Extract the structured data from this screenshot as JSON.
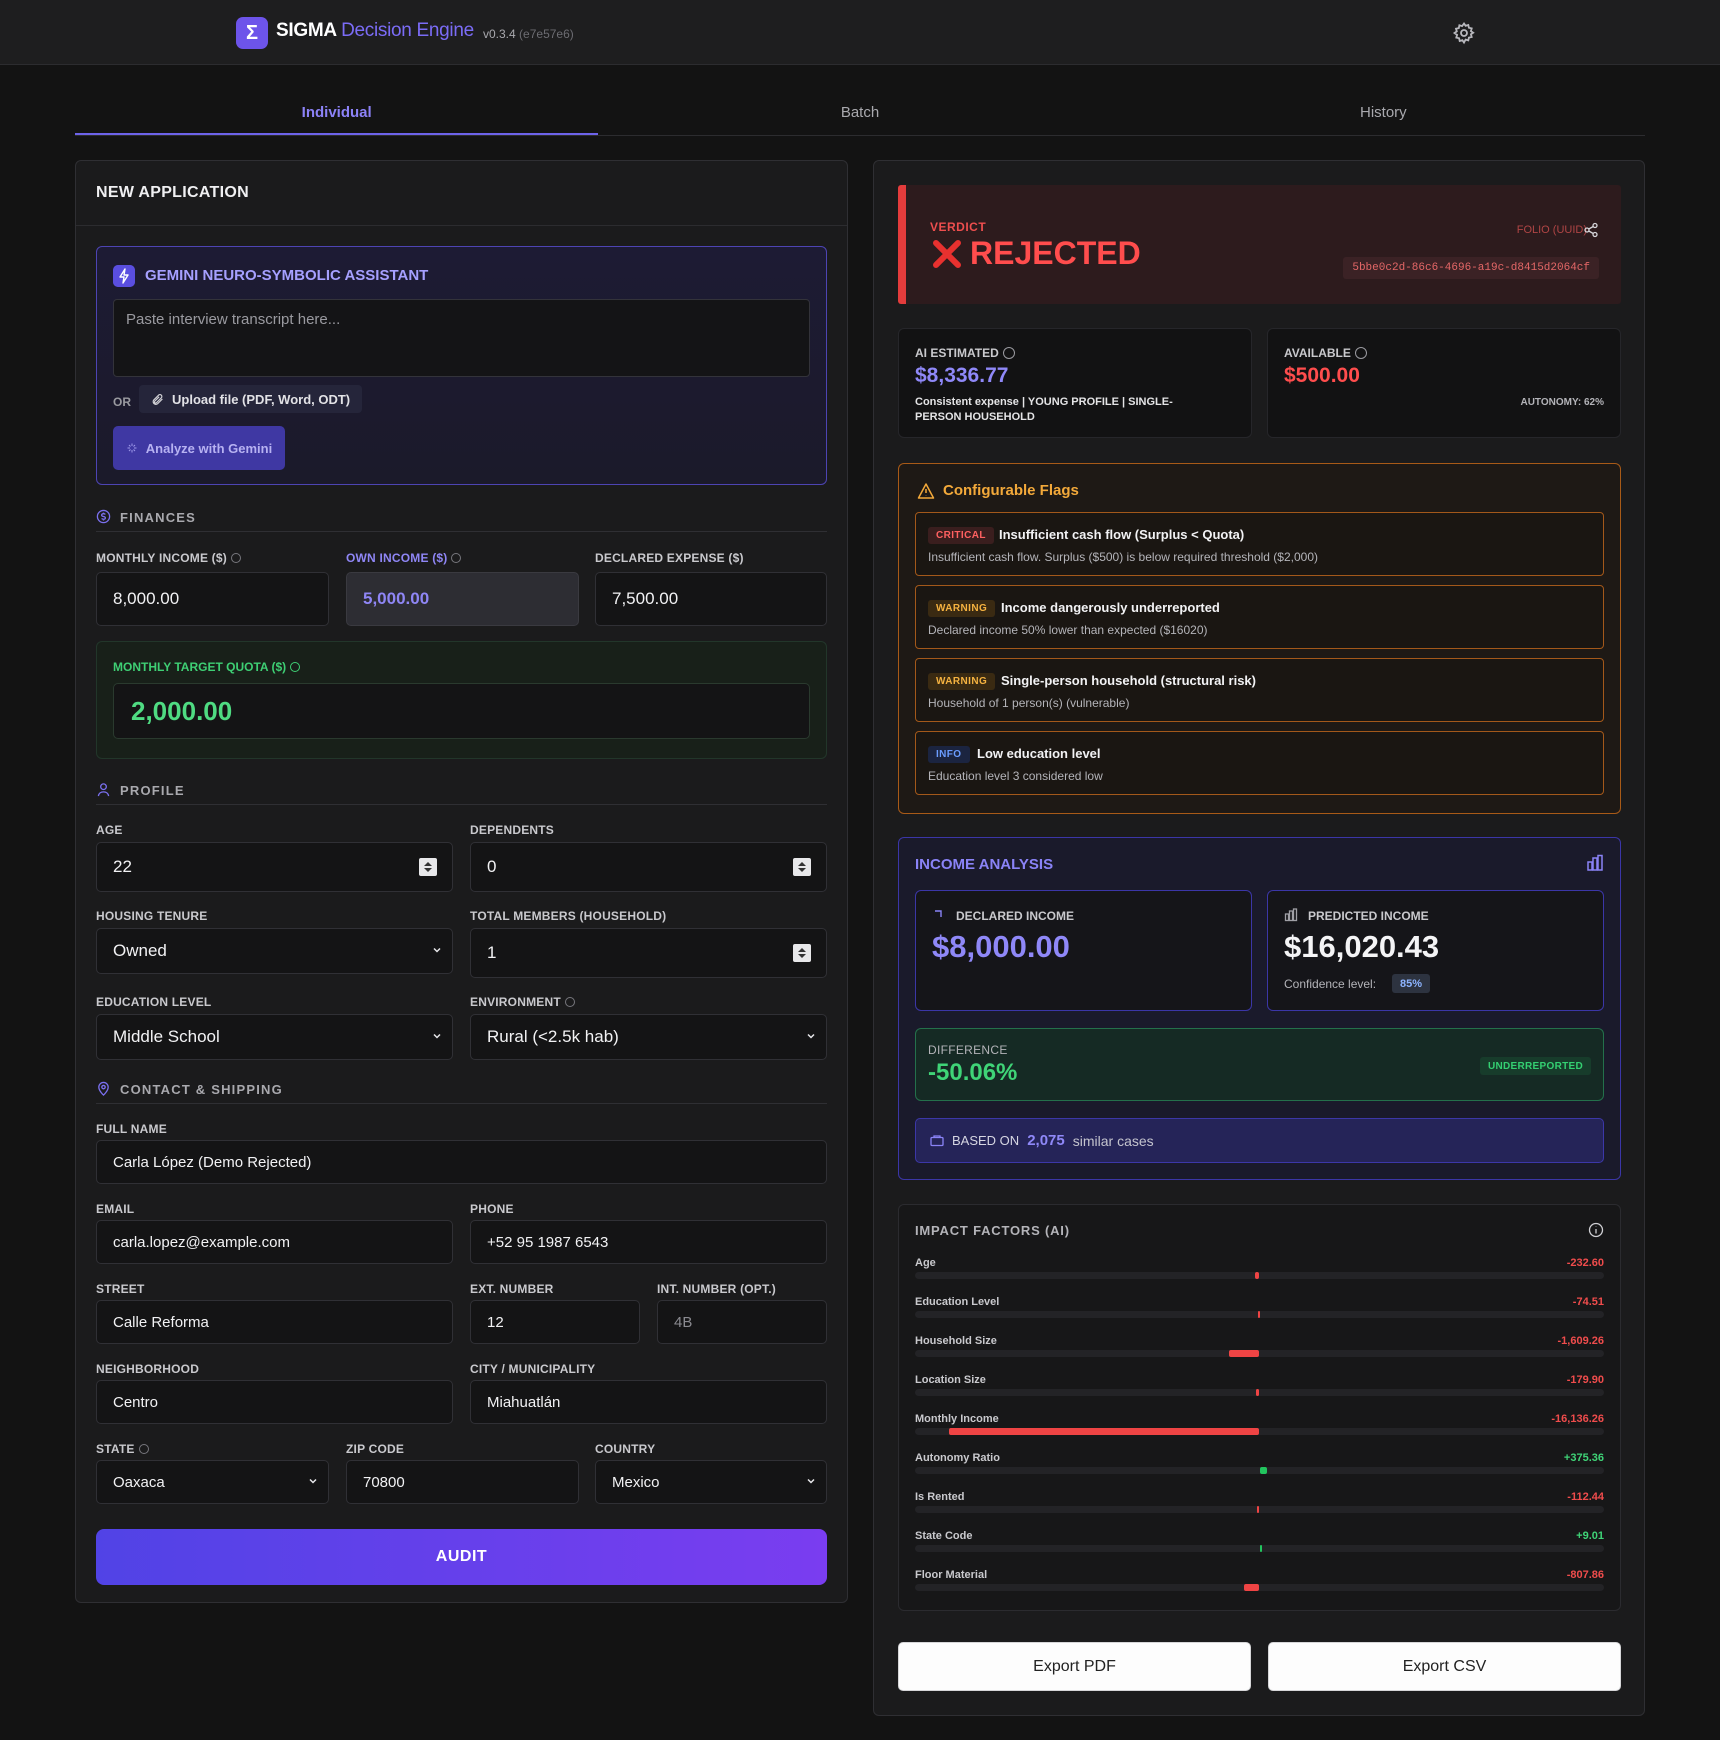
{
  "header": {
    "logo_glyph": "Σ",
    "brand": "SIGMA",
    "brand_accent": "Decision Engine",
    "version": "v0.3.4",
    "hash": "(e7e57e6)",
    "settings_icon": "gear-icon"
  },
  "tabs": [
    {
      "label": "Individual",
      "active": true
    },
    {
      "label": "Batch",
      "active": false
    },
    {
      "label": "History",
      "active": false
    }
  ],
  "form": {
    "title": "NEW APPLICATION",
    "gemini": {
      "title": "GEMINI NEURO-SYMBOLIC ASSISTANT",
      "placeholder": "Paste interview transcript here...",
      "or": "OR",
      "upload": "Upload file (PDF, Word, ODT)",
      "analyze": "Analyze with Gemini"
    },
    "finances": {
      "title": "FINANCES",
      "monthly_income_label": "MONTHLY INCOME ($)",
      "monthly_income": "8,000.00",
      "own_income_label": "OWN INCOME ($)",
      "own_income": "5,000.00",
      "declared_expense_label": "DECLARED EXPENSE ($)",
      "declared_expense": "7,500.00",
      "quota_label": "MONTHLY TARGET QUOTA ($)",
      "quota": "2,000.00"
    },
    "profile": {
      "title": "PROFILE",
      "age_label": "AGE",
      "age": "22",
      "dependents_label": "DEPENDENTS",
      "dependents": "0",
      "housing_label": "HOUSING TENURE",
      "housing": "Owned",
      "members_label": "TOTAL MEMBERS (HOUSEHOLD)",
      "members": "1",
      "education_label": "EDUCATION LEVEL",
      "education": "Middle School",
      "environment_label": "ENVIRONMENT",
      "environment": "Rural (<2.5k hab)"
    },
    "contact": {
      "title": "CONTACT & SHIPPING",
      "name_label": "FULL NAME",
      "name": "Carla López (Demo Rejected)",
      "email_label": "EMAIL",
      "email": "carla.lopez@example.com",
      "phone_label": "PHONE",
      "phone": "+52 95 1987 6543",
      "street_label": "STREET",
      "street": "Calle Reforma",
      "ext_label": "EXT. NUMBER",
      "ext": "12",
      "int_label": "INT. NUMBER (OPT.)",
      "int_placeholder": "4B",
      "neighborhood_label": "NEIGHBORHOOD",
      "neighborhood": "Centro",
      "city_label": "CITY / MUNICIPALITY",
      "city": "Miahuatlán",
      "state_label": "STATE",
      "state": "Oaxaca",
      "zip_label": "ZIP CODE",
      "zip": "70800",
      "country_label": "COUNTRY",
      "country": "Mexico"
    },
    "audit": "AUDIT"
  },
  "result": {
    "verdict_label": "VERDICT",
    "verdict": "REJECTED",
    "folio_label": "FOLIO (UUID)",
    "folio": "5bbe0c2d-86c6-4696-a19c-d8415d2064cf",
    "ai_label": "AI ESTIMATED",
    "ai_value": "$8,336.77",
    "ai_note": "Consistent expense | YOUNG PROFILE | SINGLE-PERSON HOUSEHOLD",
    "available_label": "AVAILABLE",
    "available_value": "$500.00",
    "autonomy": "AUTONOMY: 62%",
    "colors": {
      "danger": "#ff4d4d",
      "success": "#3fd477",
      "accent": "#8a83f7",
      "warning": "#f3a93a"
    }
  },
  "flags": {
    "title": "Configurable Flags",
    "items": [
      {
        "level": "CRITICAL",
        "title": "Insufficient cash flow (Surplus < Quota)",
        "desc": "Insufficient cash flow. Surplus ($500) is below required threshold ($2,000)"
      },
      {
        "level": "WARNING",
        "title": "Income dangerously underreported",
        "desc": "Declared income 50% lower than expected ($16020)"
      },
      {
        "level": "WARNING",
        "title": "Single-person household (structural risk)",
        "desc": "Household of 1 person(s) (vulnerable)"
      },
      {
        "level": "INFO",
        "title": "Low education level",
        "desc": "Education level 3 considered low"
      }
    ]
  },
  "income": {
    "title": "INCOME ANALYSIS",
    "declared_label": "DECLARED INCOME",
    "declared": "$8,000.00",
    "predicted_label": "PREDICTED INCOME",
    "predicted": "$16,020.43",
    "confidence_label": "Confidence level:",
    "confidence": "85%",
    "difference_label": "DIFFERENCE",
    "difference": "-50.06%",
    "difference_badge": "UNDERREPORTED",
    "based_on_label": "BASED ON",
    "based_on_count": "2,075",
    "based_on_suffix": "similar cases"
  },
  "impact": {
    "title": "IMPACT FACTORS (AI)",
    "max_abs": 16136.26,
    "items": [
      {
        "name": "Age",
        "label": "-232.60",
        "value": -232.6
      },
      {
        "name": "Education Level",
        "label": "-74.51",
        "value": -74.51
      },
      {
        "name": "Household Size",
        "label": "-1,609.26",
        "value": -1609.26
      },
      {
        "name": "Location Size",
        "label": "-179.90",
        "value": -179.9
      },
      {
        "name": "Monthly Income",
        "label": "-16,136.26",
        "value": -16136.26
      },
      {
        "name": "Autonomy Ratio",
        "label": "+375.36",
        "value": 375.36
      },
      {
        "name": "Is Rented",
        "label": "-112.44",
        "value": -112.44
      },
      {
        "name": "State Code",
        "label": "+9.01",
        "value": 9.01
      },
      {
        "name": "Floor Material",
        "label": "-807.86",
        "value": -807.86
      }
    ]
  },
  "export": {
    "pdf": "Export PDF",
    "csv": "Export CSV"
  }
}
